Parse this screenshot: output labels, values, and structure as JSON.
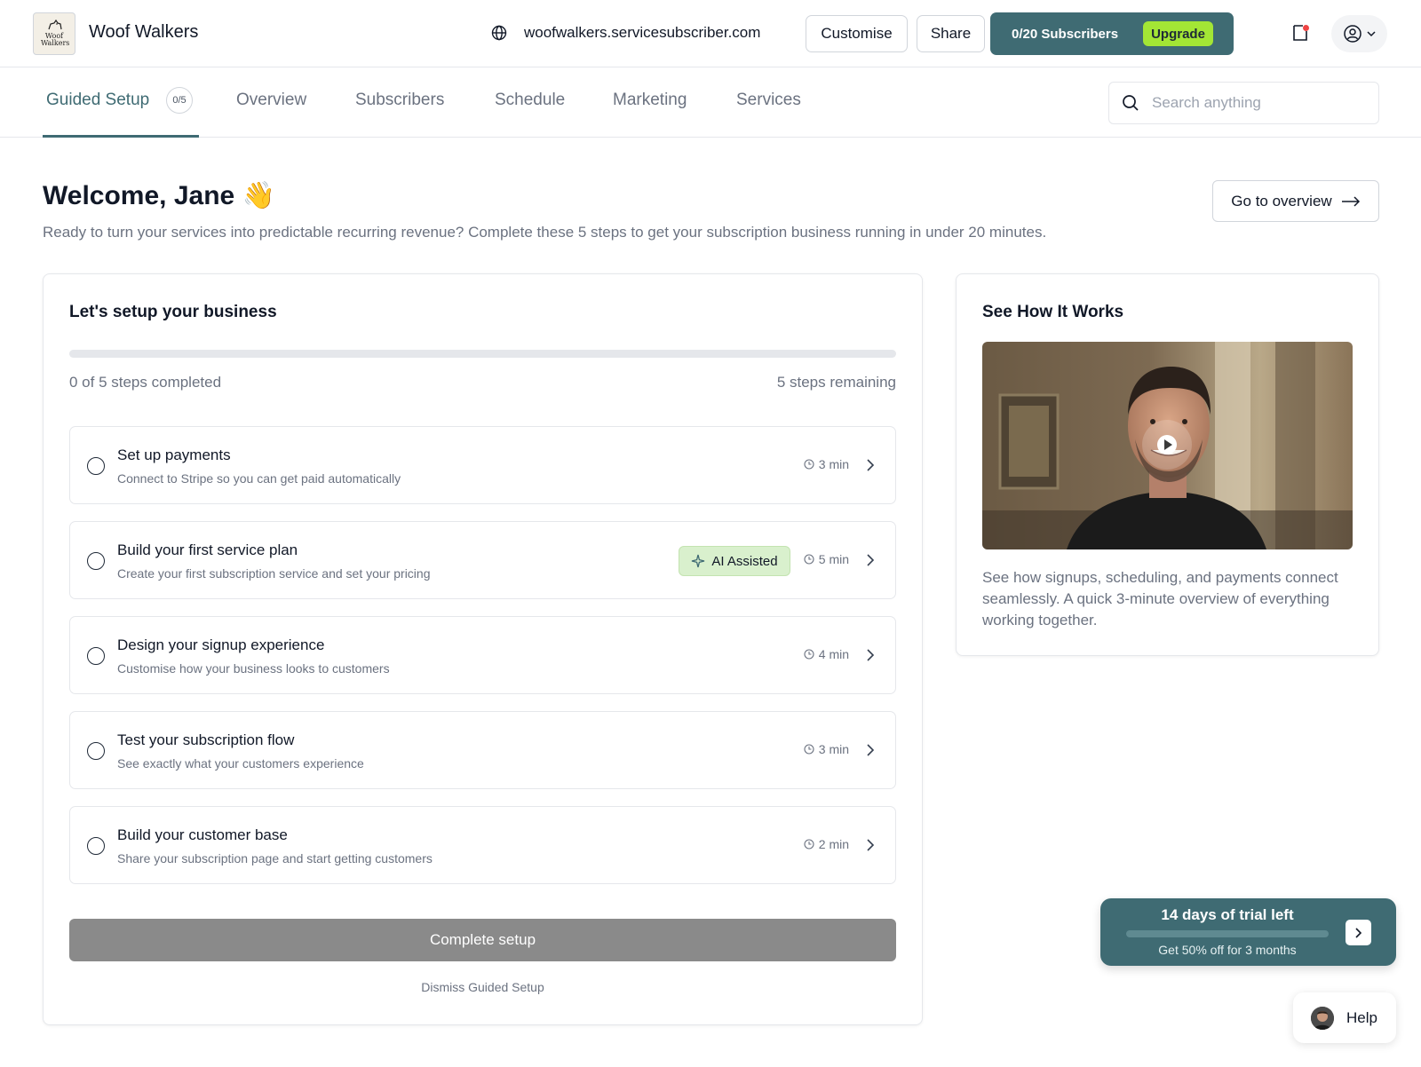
{
  "header": {
    "brand": "Woof Walkers",
    "logo_text": "Woof Walkers",
    "domain": "woofwalkers.servicesubscriber.com",
    "customise_label": "Customise",
    "share_label": "Share",
    "subscribers_text": "0/20 Subscribers",
    "upgrade_label": "Upgrade"
  },
  "nav": {
    "tabs": [
      {
        "label": "Guided Setup",
        "count": "0/5",
        "active": true
      },
      {
        "label": "Overview"
      },
      {
        "label": "Subscribers"
      },
      {
        "label": "Schedule"
      },
      {
        "label": "Marketing"
      },
      {
        "label": "Services"
      }
    ],
    "search_placeholder": "Search anything"
  },
  "welcome": {
    "title": "Welcome, Jane 👋",
    "subtitle": "Ready to turn your services into predictable recurring revenue? Complete these 5 steps to get your subscription business running in under 20 minutes.",
    "go_overview_label": "Go to overview"
  },
  "setup": {
    "title": "Let's setup your business",
    "progress_fraction": 0,
    "completed_text": "0 of 5 steps completed",
    "remaining_text": "5 steps remaining",
    "steps": [
      {
        "title": "Set up payments",
        "description": "Connect to Stripe so you can get paid automatically",
        "time": "3 min"
      },
      {
        "title": "Build your first service plan",
        "description": "Create your first subscription service and set your pricing",
        "time": "5 min",
        "badge": "AI Assisted"
      },
      {
        "title": "Design your signup experience",
        "description": "Customise how your business looks to customers",
        "time": "4 min"
      },
      {
        "title": "Test your subscription flow",
        "description": "See exactly what your customers experience",
        "time": "3 min"
      },
      {
        "title": "Build your customer base",
        "description": "Share your subscription page and start getting customers",
        "time": "2 min"
      }
    ],
    "complete_label": "Complete setup",
    "dismiss_label": "Dismiss Guided Setup"
  },
  "how_it_works": {
    "title": "See How It Works",
    "description": "See how signups, scheduling, and payments connect seamlessly. A quick 3-minute overview of everything working together."
  },
  "trial": {
    "title": "14 days of trial left",
    "subtitle": "Get 50% off for 3 months",
    "progress_fraction": 0
  },
  "help": {
    "label": "Help"
  },
  "colors": {
    "accent": "#3f6b73",
    "upgrade": "#a3e635",
    "ai_badge": "#d9f0cd",
    "complete_button": "#8a8a8a",
    "notification_dot": "#ef4444"
  }
}
